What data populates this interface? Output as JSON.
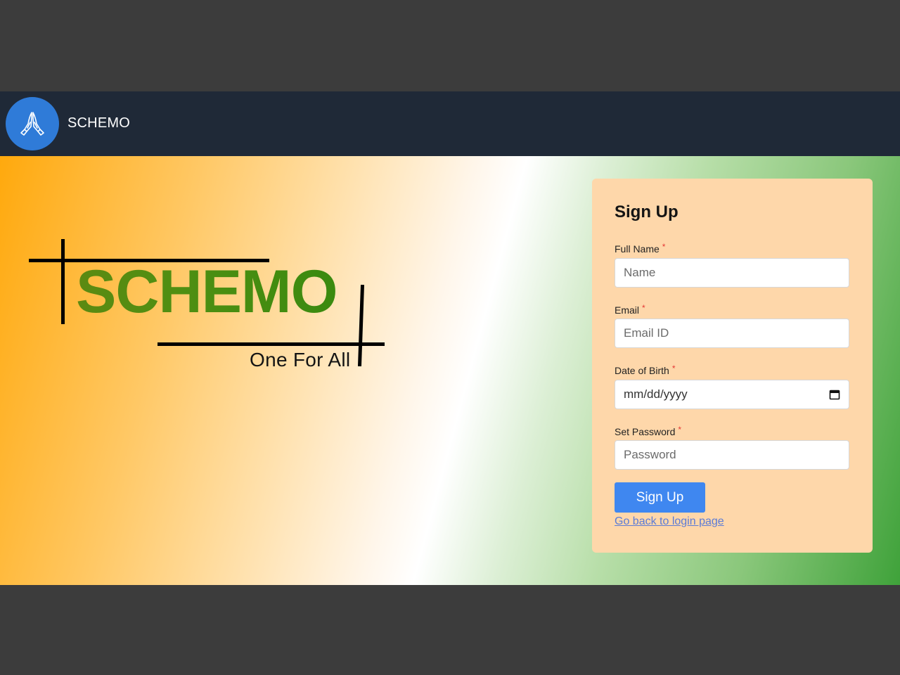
{
  "navbar": {
    "brand": "SCHEMO",
    "logo_icon": "praying-hands-icon",
    "background": "#1f2937",
    "logo_circle_color": "#2f7bd8"
  },
  "hero": {
    "logo_word": "SCHEMO",
    "tagline": "One For All",
    "word_color": "#4f8f12"
  },
  "signup": {
    "title": "Sign Up",
    "card_color": "#fed7aa",
    "fields": [
      {
        "label": "Full Name",
        "required_mark": "*",
        "placeholder": "Name"
      },
      {
        "label": "Email",
        "required_mark": "*",
        "placeholder": "Email ID"
      },
      {
        "label": "Date of Birth",
        "required_mark": "*",
        "placeholder": "mm/dd/yyyy"
      },
      {
        "label": "Set Password",
        "required_mark": "*",
        "placeholder": "Password"
      }
    ],
    "button_label": "Sign Up",
    "button_color": "#3f87f0",
    "back_link": "Go back to login page"
  }
}
